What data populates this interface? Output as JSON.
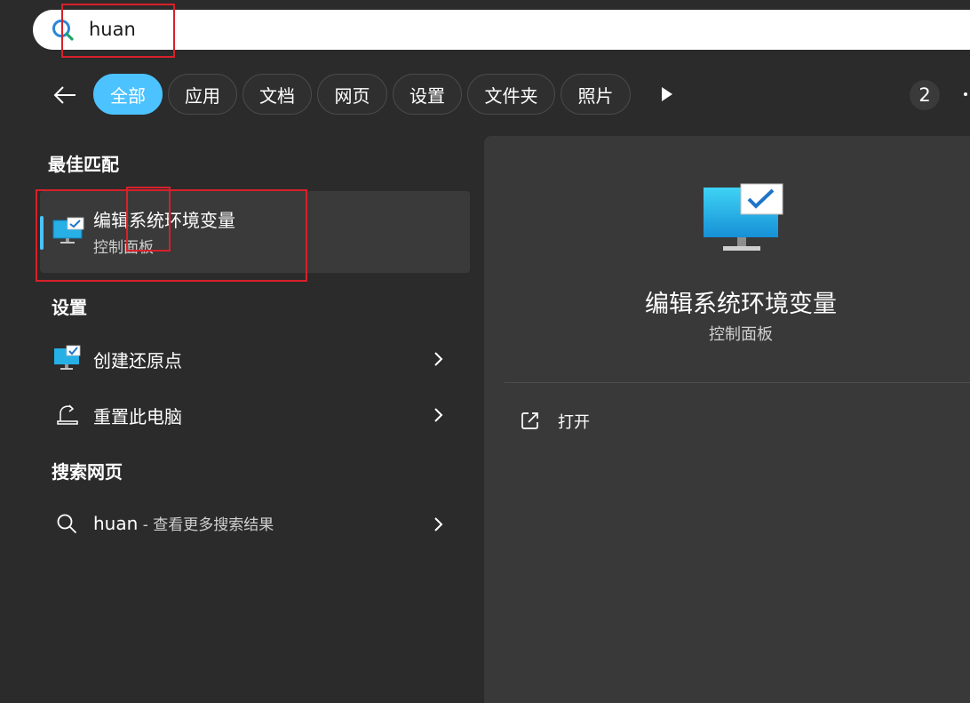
{
  "search": {
    "value": "huan",
    "placeholder": ""
  },
  "filters": {
    "tabs": [
      {
        "label": "全部",
        "active": true
      },
      {
        "label": "应用",
        "active": false
      },
      {
        "label": "文档",
        "active": false
      },
      {
        "label": "网页",
        "active": false
      },
      {
        "label": "设置",
        "active": false
      },
      {
        "label": "文件夹",
        "active": false
      },
      {
        "label": "照片",
        "active": false
      }
    ],
    "count_badge": "2"
  },
  "results": {
    "best_match": {
      "heading": "最佳匹配",
      "title": "编辑系统环境变量",
      "subtitle": "控制面板",
      "icon": "control-panel-monitor-icon"
    },
    "settings": {
      "heading": "设置",
      "items": [
        {
          "label": "创建还原点",
          "icon": "restore-point-monitor-icon"
        },
        {
          "label": "重置此电脑",
          "icon": "reset-pc-icon"
        }
      ]
    },
    "web": {
      "heading": "搜索网页",
      "query": "huan",
      "suffix": " - 查看更多搜索结果",
      "icon": "search-icon"
    }
  },
  "detail": {
    "title": "编辑系统环境变量",
    "subtitle": "控制面板",
    "actions": [
      {
        "label": "打开",
        "icon": "open-external-icon"
      }
    ]
  },
  "colors": {
    "accent": "#4cc2ff",
    "background": "#2b2b2b",
    "panel": "#393939",
    "annotation": "#d8202a"
  }
}
